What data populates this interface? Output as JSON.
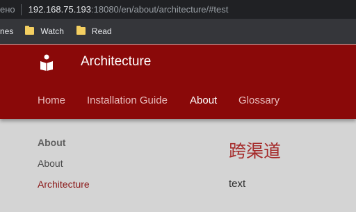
{
  "browser": {
    "tab_fragment": "ено",
    "url_host": "192.168.75.193",
    "url_rest": ":18080/en/about/architecture/#test"
  },
  "bookmarks": {
    "cut_label": "nes",
    "items": [
      {
        "label": "Watch",
        "icon": "folder-icon"
      },
      {
        "label": "Read",
        "icon": "folder-icon"
      }
    ]
  },
  "site": {
    "title": "Architecture",
    "logo_icon": "book-reader-icon",
    "header_color": "#8a0909"
  },
  "nav": {
    "items": [
      {
        "label": "Home"
      },
      {
        "label": "Installation Guide"
      },
      {
        "label": "About"
      },
      {
        "label": "Glossary"
      }
    ],
    "active": "About"
  },
  "sidebar": {
    "heading": "About",
    "items": [
      {
        "label": "About"
      },
      {
        "label": "Architecture"
      }
    ],
    "current": "Architecture"
  },
  "content": {
    "title": "跨渠道",
    "text": "text"
  }
}
